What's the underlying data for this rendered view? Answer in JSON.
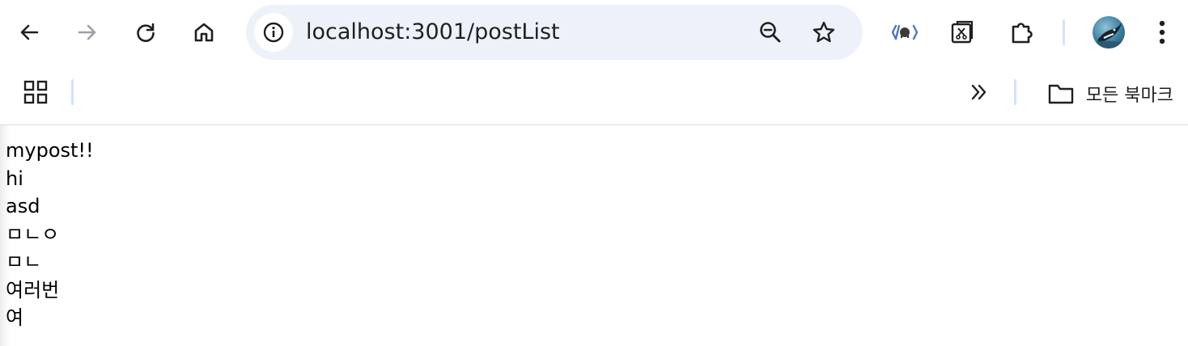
{
  "browser": {
    "url": "localhost:3001/postList",
    "toolbar": {
      "back": "arrow-left-icon",
      "forward": "arrow-right-icon",
      "reload": "reload-icon",
      "home": "home-icon"
    },
    "bookmarks_bar": {
      "overflow": "double-chevron-right-icon",
      "all_bookmarks_label": "모든 북마크"
    },
    "colors": {
      "omnibox_bg": "#edf2fa",
      "divider": "#d3e3fd",
      "icon": "#1f1f1f",
      "icon_disabled": "#9aa0a6",
      "extension_blue": "#4b77c8"
    }
  },
  "page": {
    "posts": [
      "mypost!!",
      "hi",
      "asd",
      "ㅁㄴㅇ",
      "ㅁㄴ",
      "여러번",
      "여"
    ]
  }
}
